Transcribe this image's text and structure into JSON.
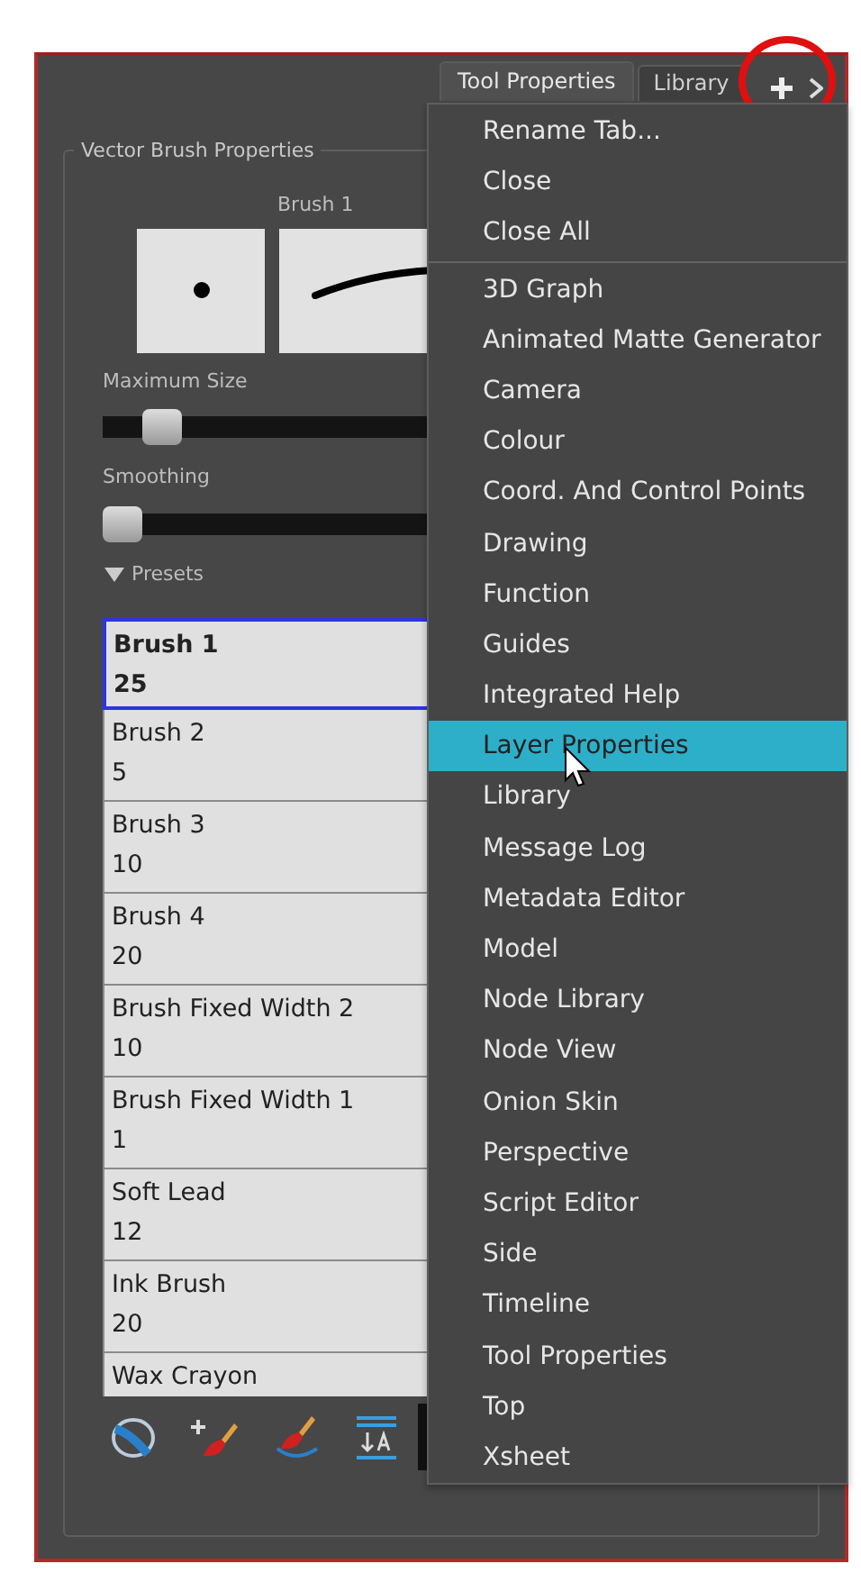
{
  "tabs": [
    {
      "label": "Tool Properties",
      "selected": true
    },
    {
      "label": "Library",
      "selected": false
    }
  ],
  "group_title": "Vector Brush Properties",
  "brush_preview": {
    "label": "Brush 1"
  },
  "sliders": [
    {
      "label": "Maximum Size",
      "level": 0.08
    },
    {
      "label": "Smoothing",
      "level": 0
    }
  ],
  "presets": {
    "label": "Presets",
    "expanded": true,
    "items": [
      {
        "name": "Brush 1",
        "size": "25",
        "selected": true
      },
      {
        "name": "Brush 2",
        "size": "5",
        "selected": false
      },
      {
        "name": "Brush 3",
        "size": "10",
        "selected": false
      },
      {
        "name": "Brush 4",
        "size": "20",
        "selected": false
      },
      {
        "name": "Brush Fixed Width 2",
        "size": "10",
        "selected": false
      },
      {
        "name": "Brush Fixed Width 1",
        "size": "1",
        "selected": false
      },
      {
        "name": "Soft Lead",
        "size": "12",
        "selected": false
      },
      {
        "name": "Ink Brush",
        "size": "20",
        "selected": false
      },
      {
        "name": "Wax Crayon",
        "selected": false
      }
    ]
  },
  "menu": {
    "sections": [
      {
        "items": [
          {
            "label": "Rename Tab...",
            "selected": false
          },
          {
            "label": "Close",
            "selected": false
          },
          {
            "label": "Close All",
            "selected": false
          }
        ]
      },
      {
        "items": [
          {
            "label": "3D Graph",
            "selected": false
          },
          {
            "label": "Animated Matte Generator",
            "selected": false
          },
          {
            "label": "Camera",
            "selected": false
          },
          {
            "label": "Colour",
            "selected": false
          },
          {
            "label": "Coord. And Control Points",
            "selected": false
          },
          {
            "label": "Drawing",
            "selected": false
          },
          {
            "label": "Function",
            "selected": false
          },
          {
            "label": "Guides",
            "selected": false
          },
          {
            "label": "Integrated Help",
            "selected": false
          },
          {
            "label": "Layer Properties",
            "selected": true
          },
          {
            "label": "Library",
            "selected": false
          },
          {
            "label": "Message Log",
            "selected": false
          },
          {
            "label": "Metadata Editor",
            "selected": false
          },
          {
            "label": "Model",
            "selected": false
          },
          {
            "label": "Node Library",
            "selected": false
          },
          {
            "label": "Node View",
            "selected": false
          },
          {
            "label": "Onion Skin",
            "selected": false
          },
          {
            "label": "Perspective",
            "selected": false
          },
          {
            "label": "Script Editor",
            "selected": false
          },
          {
            "label": "Side",
            "selected": false
          },
          {
            "label": "Timeline",
            "selected": false
          },
          {
            "label": "Tool Properties",
            "selected": false
          },
          {
            "label": "Top",
            "selected": false
          },
          {
            "label": "Xsheet",
            "selected": false
          }
        ]
      }
    ]
  }
}
